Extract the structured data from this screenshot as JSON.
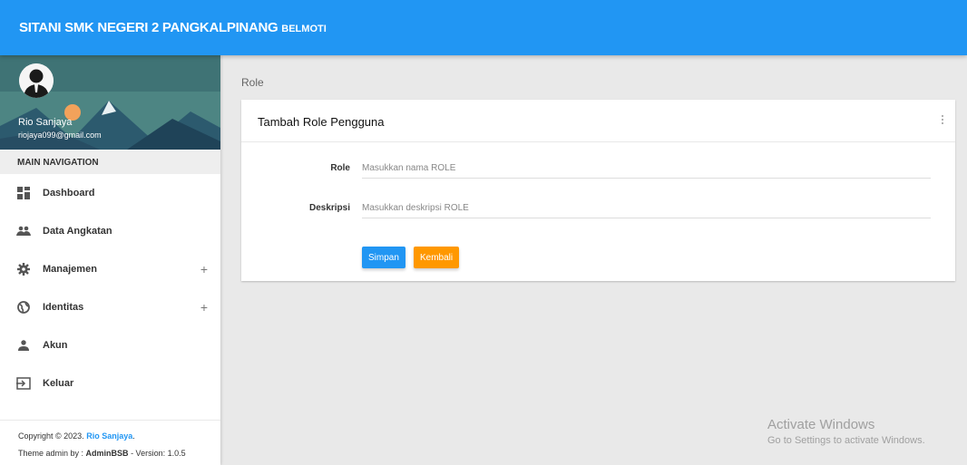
{
  "header": {
    "brand": "SITANI SMK NEGERI 2 PANGKALPINANG",
    "brand_sub": "BELMOTI"
  },
  "user": {
    "name": "Rio Sanjaya",
    "email": "riojaya099@gmail.com"
  },
  "sidebar": {
    "nav_header": "MAIN NAVIGATION",
    "items": [
      {
        "label": "Dashboard",
        "icon": "dashboard-icon"
      },
      {
        "label": "Data Angkatan",
        "icon": "people-icon"
      },
      {
        "label": "Manajemen",
        "icon": "gear-icon",
        "expand": "+"
      },
      {
        "label": "Identitas",
        "icon": "globe-icon",
        "expand": "+"
      },
      {
        "label": "Akun",
        "icon": "person-icon"
      },
      {
        "label": "Keluar",
        "icon": "logout-icon"
      }
    ],
    "footer": {
      "copyright": "Copyright © 2023.",
      "author": "Rio Sanjaya",
      "period": ".",
      "theme_prefix": "Theme admin by :",
      "theme_name": "AdminBSB",
      "version": "- Version: 1.0.5"
    }
  },
  "main": {
    "page_title": "Role",
    "card_title": "Tambah Role Pengguna",
    "form": {
      "role_label": "Role",
      "role_placeholder": "Masukkan nama ROLE",
      "role_value": "",
      "desc_label": "Deskripsi",
      "desc_placeholder": "Masukkan deskripsi ROLE",
      "desc_value": "",
      "save_label": "Simpan",
      "back_label": "Kembali"
    }
  },
  "watermark": {
    "line1": "Activate Windows",
    "line2": "Go to Settings to activate Windows."
  },
  "colors": {
    "primary": "#2196f3",
    "warning": "#ff9800",
    "background": "#e9e9e9"
  }
}
